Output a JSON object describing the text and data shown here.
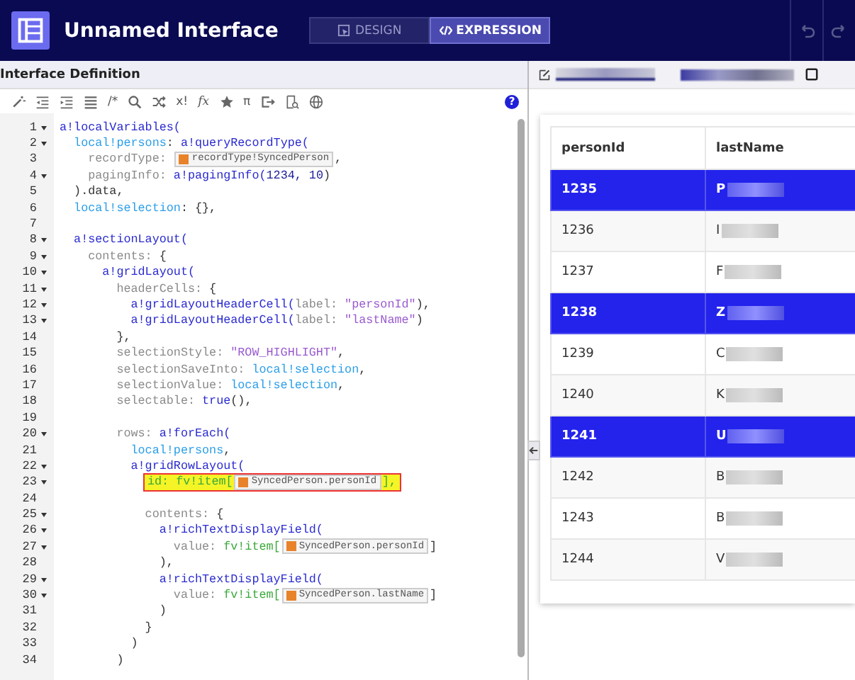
{
  "header": {
    "title": "Unnamed Interface",
    "tabs": [
      {
        "label": "DESIGN",
        "selected": false
      },
      {
        "label": "EXPRESSION",
        "selected": true
      }
    ]
  },
  "editor": {
    "title": "Interface Definition",
    "toolbar_labels": [
      "/*",
      "x!",
      "fx",
      "π"
    ],
    "help": "?",
    "lines": [
      {
        "num": "1",
        "foldable": true,
        "highlighted": false,
        "tokens": [
          {
            "kind": "fn",
            "text": "a!localVariables("
          }
        ]
      },
      {
        "num": "2",
        "foldable": true,
        "highlighted": false,
        "tokens": [
          {
            "kind": "var",
            "text": "  local!persons"
          },
          {
            "kind": "plain",
            "text": ": "
          },
          {
            "kind": "fn",
            "text": "a!queryRecordType("
          }
        ]
      },
      {
        "num": "3",
        "foldable": false,
        "highlighted": false,
        "tokens": [
          {
            "kind": "key",
            "text": "    recordType: "
          },
          {
            "kind": "rec",
            "text": "recordType!SyncedPerson"
          },
          {
            "kind": "plain",
            "text": ","
          }
        ]
      },
      {
        "num": "4",
        "foldable": true,
        "highlighted": false,
        "tokens": [
          {
            "kind": "key",
            "text": "    pagingInfo: "
          },
          {
            "kind": "fn",
            "text": "a!pagingInfo("
          },
          {
            "kind": "num",
            "text": "1234, 10"
          },
          {
            "kind": "plain",
            "text": ")"
          }
        ]
      },
      {
        "num": "5",
        "foldable": false,
        "highlighted": false,
        "tokens": [
          {
            "kind": "plain",
            "text": "  ).data,"
          }
        ]
      },
      {
        "num": "6",
        "foldable": false,
        "highlighted": false,
        "tokens": [
          {
            "kind": "var",
            "text": "  local!selection"
          },
          {
            "kind": "plain",
            "text": ": {},"
          }
        ]
      },
      {
        "num": "7",
        "foldable": false,
        "highlighted": false
      },
      {
        "num": "8",
        "foldable": true,
        "highlighted": false,
        "tokens": [
          {
            "kind": "fn",
            "text": "  a!sectionLayout("
          }
        ]
      },
      {
        "num": "9",
        "foldable": true,
        "highlighted": false,
        "tokens": [
          {
            "kind": "key",
            "text": "    contents: "
          },
          {
            "kind": "plain",
            "text": "{"
          }
        ]
      },
      {
        "num": "10",
        "foldable": true,
        "highlighted": false,
        "tokens": [
          {
            "kind": "fn",
            "text": "      a!gridLayout("
          }
        ]
      },
      {
        "num": "11",
        "foldable": true,
        "highlighted": false,
        "tokens": [
          {
            "kind": "key",
            "text": "        headerCells: "
          },
          {
            "kind": "plain",
            "text": "{"
          }
        ]
      },
      {
        "num": "12",
        "foldable": true,
        "highlighted": false,
        "tokens": [
          {
            "kind": "fn",
            "text": "          a!gridLayoutHeaderCell("
          },
          {
            "kind": "key",
            "text": "label: "
          },
          {
            "kind": "str",
            "text": "\"personId\""
          },
          {
            "kind": "plain",
            "text": "),"
          }
        ]
      },
      {
        "num": "13",
        "foldable": true,
        "highlighted": false,
        "tokens": [
          {
            "kind": "fn",
            "text": "          a!gridLayoutHeaderCell("
          },
          {
            "kind": "key",
            "text": "label: "
          },
          {
            "kind": "str",
            "text": "\"lastName\""
          },
          {
            "kind": "plain",
            "text": ")"
          }
        ]
      },
      {
        "num": "14",
        "foldable": false,
        "highlighted": false,
        "tokens": [
          {
            "kind": "plain",
            "text": "        },"
          }
        ]
      },
      {
        "num": "15",
        "foldable": false,
        "highlighted": false,
        "tokens": [
          {
            "kind": "key",
            "text": "        selectionStyle: "
          },
          {
            "kind": "str",
            "text": "\"ROW_HIGHLIGHT\""
          },
          {
            "kind": "plain",
            "text": ","
          }
        ]
      },
      {
        "num": "16",
        "foldable": false,
        "highlighted": false,
        "tokens": [
          {
            "kind": "key",
            "text": "        selectionSaveInto: "
          },
          {
            "kind": "var",
            "text": "local!selection"
          },
          {
            "kind": "plain",
            "text": ","
          }
        ]
      },
      {
        "num": "17",
        "foldable": false,
        "highlighted": false,
        "tokens": [
          {
            "kind": "key",
            "text": "        selectionValue: "
          },
          {
            "kind": "var",
            "text": "local!selection"
          },
          {
            "kind": "plain",
            "text": ","
          }
        ]
      },
      {
        "num": "18",
        "foldable": false,
        "highlighted": false,
        "tokens": [
          {
            "kind": "key",
            "text": "        selectable: "
          },
          {
            "kind": "fn",
            "text": "true"
          },
          {
            "kind": "plain",
            "text": "(),"
          }
        ]
      },
      {
        "num": "19",
        "foldable": false,
        "highlighted": false
      },
      {
        "num": "20",
        "foldable": true,
        "highlighted": false,
        "tokens": [
          {
            "kind": "key",
            "text": "        rows: "
          },
          {
            "kind": "fn",
            "text": "a!forEach("
          }
        ]
      },
      {
        "num": "21",
        "foldable": false,
        "highlighted": false,
        "tokens": [
          {
            "kind": "var",
            "text": "          local!persons"
          },
          {
            "kind": "plain",
            "text": ","
          }
        ]
      },
      {
        "num": "22",
        "foldable": true,
        "highlighted": false,
        "tokens": [
          {
            "kind": "fn",
            "text": "          a!gridRowLayout("
          }
        ]
      },
      {
        "num": "23",
        "foldable": true,
        "highlighted": true,
        "tokens": [
          {
            "kind": "item",
            "text": "id: fv!item["
          },
          {
            "kind": "rec",
            "text": "SyncedPerson.personId"
          },
          {
            "kind": "item",
            "text": "],"
          }
        ]
      },
      {
        "num": "24",
        "foldable": false,
        "highlighted": false
      },
      {
        "num": "25",
        "foldable": true,
        "highlighted": false,
        "tokens": [
          {
            "kind": "key",
            "text": "            contents: "
          },
          {
            "kind": "plain",
            "text": "{"
          }
        ]
      },
      {
        "num": "26",
        "foldable": true,
        "highlighted": false,
        "tokens": [
          {
            "kind": "fn",
            "text": "              a!richTextDisplayField("
          }
        ]
      },
      {
        "num": "27",
        "foldable": true,
        "highlighted": false,
        "tokens": [
          {
            "kind": "key",
            "text": "                value: "
          },
          {
            "kind": "item",
            "text": "fv!item["
          },
          {
            "kind": "rec",
            "text": "SyncedPerson.personId"
          },
          {
            "kind": "plain",
            "text": "]"
          }
        ]
      },
      {
        "num": "28",
        "foldable": false,
        "highlighted": false,
        "tokens": [
          {
            "kind": "plain",
            "text": "              ),"
          }
        ]
      },
      {
        "num": "29",
        "foldable": true,
        "highlighted": false,
        "tokens": [
          {
            "kind": "fn",
            "text": "              a!richTextDisplayField("
          }
        ]
      },
      {
        "num": "30",
        "foldable": true,
        "highlighted": false,
        "tokens": [
          {
            "kind": "key",
            "text": "                value: "
          },
          {
            "kind": "item",
            "text": "fv!item["
          },
          {
            "kind": "rec",
            "text": "SyncedPerson.lastName"
          },
          {
            "kind": "plain",
            "text": "]"
          }
        ]
      },
      {
        "num": "31",
        "foldable": false,
        "highlighted": false,
        "tokens": [
          {
            "kind": "plain",
            "text": "              )"
          }
        ]
      },
      {
        "num": "32",
        "foldable": false,
        "highlighted": false,
        "tokens": [
          {
            "kind": "plain",
            "text": "            }"
          }
        ]
      },
      {
        "num": "33",
        "foldable": false,
        "highlighted": false,
        "tokens": [
          {
            "kind": "plain",
            "text": "          )"
          }
        ]
      },
      {
        "num": "34",
        "foldable": false,
        "highlighted": false,
        "tokens": [
          {
            "kind": "plain",
            "text": "        )"
          }
        ]
      }
    ]
  },
  "preview": {
    "table": {
      "columns": [
        "personId",
        "lastName"
      ],
      "rows": [
        {
          "personId": "1235",
          "lastName": "P",
          "selected": true
        },
        {
          "personId": "1236",
          "lastName": "I",
          "selected": false
        },
        {
          "personId": "1237",
          "lastName": "F",
          "selected": false
        },
        {
          "personId": "1238",
          "lastName": "Z",
          "selected": true
        },
        {
          "personId": "1239",
          "lastName": "C",
          "selected": false
        },
        {
          "personId": "1240",
          "lastName": "K",
          "selected": false
        },
        {
          "personId": "1241",
          "lastName": "U",
          "selected": true
        },
        {
          "personId": "1242",
          "lastName": "B",
          "selected": false
        },
        {
          "personId": "1243",
          "lastName": "B",
          "selected": false
        },
        {
          "personId": "1244",
          "lastName": "V",
          "selected": false
        }
      ]
    }
  }
}
